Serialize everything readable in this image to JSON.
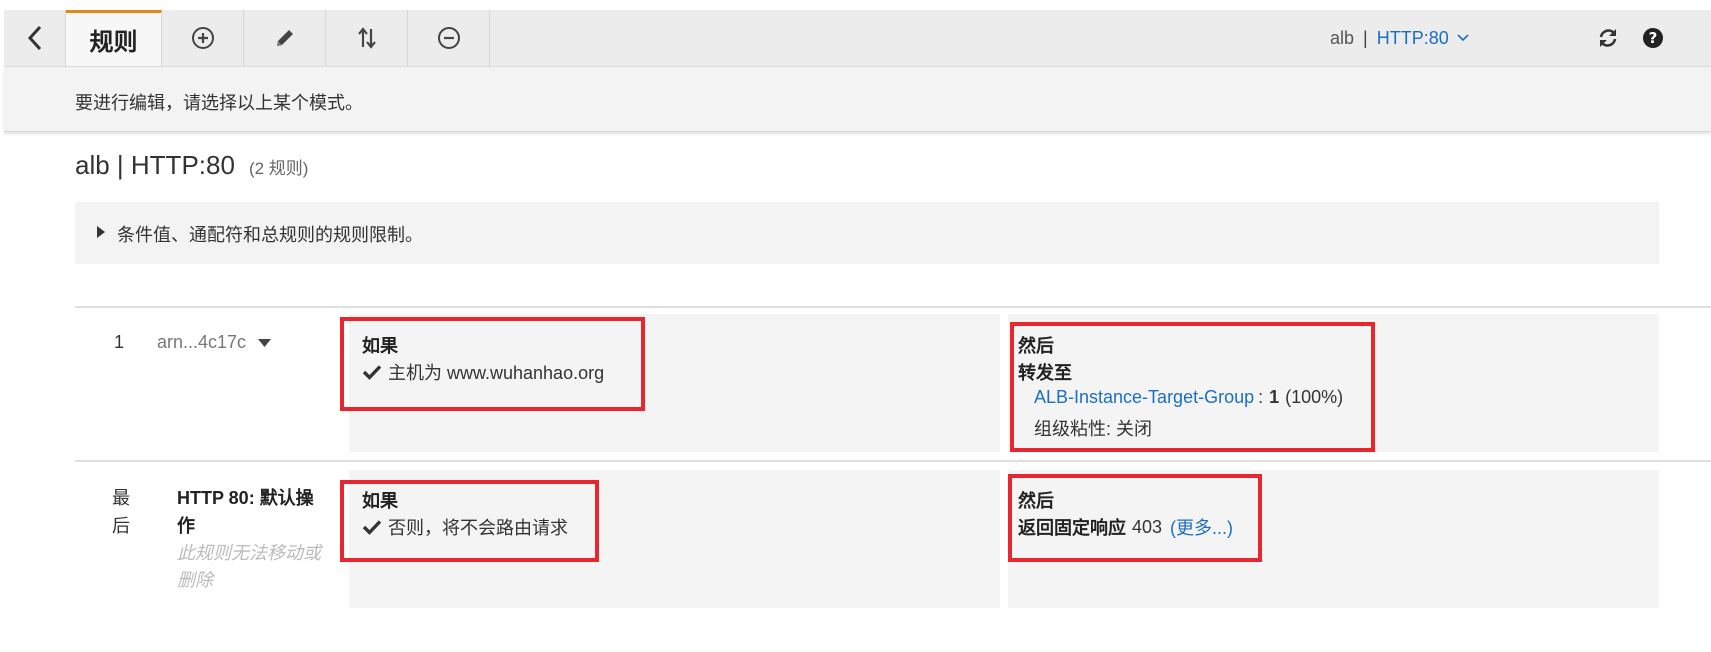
{
  "toolbar": {
    "active_tab": "规则",
    "lb_name": "alb",
    "separator": "|",
    "listener": "HTTP:80"
  },
  "hint": "要进行编辑，请选择以上某个模式。",
  "page": {
    "title": "alb | HTTP:80",
    "rule_count": "(2 规则)"
  },
  "limits_text": "条件值、通配符和总规则的规则限制。",
  "rules": [
    {
      "number": "1",
      "arn": "arn...4c17c",
      "if_label": "如果",
      "condition": "主机为 www.wuhanhao.org",
      "then_label": "然后",
      "action_label": "转发至",
      "target_group": "ALB-Instance-Target-Group",
      "weight_sep": ":",
      "weight": "1",
      "weight_pct": "(100%)",
      "stickiness": "组级粘性: 关闭"
    },
    {
      "number": "最后",
      "name": "HTTP 80: 默认操作",
      "note": "此规则无法移动或删除",
      "if_label": "如果",
      "condition": "否则，将不会路由请求",
      "then_label": "然后",
      "action_label": "返回固定响应",
      "status_code": "403",
      "more_link": "(更多...)"
    }
  ],
  "icons": {
    "back": "chevron-left-icon",
    "add": "plus-circle-icon",
    "edit": "pencil-icon",
    "sort": "sort-arrows-icon",
    "remove": "minus-circle-icon",
    "refresh": "refresh-icon",
    "help": "help-circle-icon"
  },
  "colors": {
    "accent": "#e38a16",
    "link": "#1a6fc4",
    "highlight": "#e8262e"
  }
}
